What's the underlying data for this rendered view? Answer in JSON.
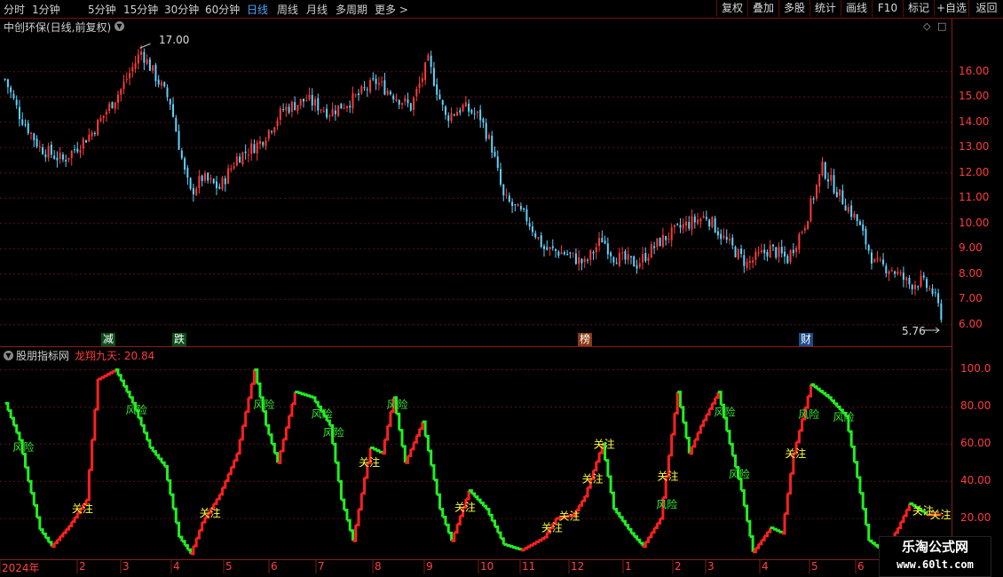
{
  "toolbar": {
    "periods": [
      "分时",
      "1分钟",
      "5分钟",
      "15分钟",
      "30分钟",
      "60分钟",
      "日线",
      "周线",
      "月线",
      "多周期",
      "更多 >"
    ],
    "active_period": "日线",
    "right_buttons": [
      "复权",
      "叠加",
      "多股",
      "统计",
      "画线",
      "F10",
      "标记",
      "+自选",
      "返回"
    ]
  },
  "main_panel": {
    "title": "中创环保(日线,前复权)",
    "high_label": "17.00",
    "low_label": "5.76",
    "y_ticks": [
      "16.00",
      "15.00",
      "14.00",
      "13.00",
      "12.00",
      "11.00",
      "10.00",
      "9.00",
      "8.00",
      "7.00",
      "6.00"
    ],
    "event_tags": [
      "减",
      "跌",
      "榜",
      "财"
    ]
  },
  "indicator_panel": {
    "source": "股朋指标网",
    "name_value": "龙翔九天: 20.84",
    "y_ticks": [
      "100.0",
      "80.00",
      "60.00",
      "40.00",
      "20.00"
    ],
    "label_risk": "风险",
    "label_watch": "关注"
  },
  "x_axis": {
    "months": [
      "2024年",
      "2",
      "3",
      "4",
      "5",
      "6",
      "7",
      "8",
      "9",
      "10",
      "11",
      "12",
      "1",
      "2",
      "3",
      "4",
      "5",
      "6"
    ]
  },
  "watermark": {
    "line1": "乐淘公式网",
    "line2": "www.60lt.com"
  },
  "colors": {
    "up": "#ff3a3a",
    "down": "#5fd3ff",
    "ind_up": "#ff2020",
    "ind_down": "#22ee22",
    "risk": "#33ee33",
    "watch": "#ffff40"
  },
  "chart_data": {
    "type": "candlestick_with_indicator",
    "price_ylim": [
      5.5,
      17.5
    ],
    "price_high": 17.0,
    "price_low": 5.76,
    "price_path": [
      [
        0,
        15.7
      ],
      [
        5,
        14.3
      ],
      [
        12,
        13.0
      ],
      [
        20,
        12.5
      ],
      [
        30,
        13.6
      ],
      [
        40,
        15.3
      ],
      [
        47,
        16.8
      ],
      [
        52,
        15.8
      ],
      [
        57,
        14.8
      ],
      [
        62,
        12.0
      ],
      [
        64,
        11.2
      ],
      [
        68,
        11.8
      ],
      [
        74,
        11.4
      ],
      [
        80,
        12.6
      ],
      [
        88,
        13.2
      ],
      [
        96,
        14.5
      ],
      [
        104,
        14.9
      ],
      [
        112,
        14.4
      ],
      [
        120,
        14.9
      ],
      [
        128,
        15.6
      ],
      [
        134,
        15.1
      ],
      [
        140,
        14.6
      ],
      [
        146,
        16.4
      ],
      [
        152,
        14.2
      ],
      [
        158,
        14.6
      ],
      [
        164,
        14.2
      ],
      [
        168,
        13.0
      ],
      [
        172,
        11.0
      ],
      [
        180,
        10.2
      ],
      [
        186,
        9.0
      ],
      [
        194,
        8.8
      ],
      [
        200,
        8.4
      ],
      [
        206,
        9.4
      ],
      [
        210,
        8.7
      ],
      [
        218,
        8.4
      ],
      [
        226,
        9.3
      ],
      [
        234,
        9.9
      ],
      [
        242,
        10.3
      ],
      [
        248,
        9.4
      ],
      [
        256,
        8.4
      ],
      [
        264,
        9.0
      ],
      [
        270,
        8.6
      ],
      [
        276,
        10.0
      ],
      [
        282,
        12.2
      ],
      [
        288,
        11.1
      ],
      [
        294,
        10.1
      ],
      [
        300,
        8.4
      ],
      [
        306,
        8.2
      ],
      [
        312,
        7.6
      ],
      [
        316,
        7.7
      ],
      [
        320,
        7.3
      ],
      [
        323,
        6.4
      ]
    ],
    "indicator_ylim": [
      0,
      105
    ],
    "indicator_path": [
      [
        0,
        82
      ],
      [
        5,
        62
      ],
      [
        8,
        40
      ],
      [
        12,
        14
      ],
      [
        16,
        5
      ],
      [
        22,
        16
      ],
      [
        28,
        30
      ],
      [
        32,
        95
      ],
      [
        38,
        100
      ],
      [
        44,
        82
      ],
      [
        50,
        58
      ],
      [
        55,
        48
      ],
      [
        60,
        10
      ],
      [
        64,
        1
      ],
      [
        68,
        18
      ],
      [
        74,
        33
      ],
      [
        80,
        55
      ],
      [
        86,
        100
      ],
      [
        90,
        70
      ],
      [
        94,
        50
      ],
      [
        100,
        88
      ],
      [
        106,
        85
      ],
      [
        112,
        70
      ],
      [
        116,
        30
      ],
      [
        120,
        8
      ],
      [
        124,
        42
      ],
      [
        126,
        58
      ],
      [
        130,
        55
      ],
      [
        134,
        85
      ],
      [
        138,
        50
      ],
      [
        144,
        72
      ],
      [
        150,
        25
      ],
      [
        154,
        8
      ],
      [
        160,
        35
      ],
      [
        166,
        25
      ],
      [
        172,
        6
      ],
      [
        178,
        3
      ],
      [
        186,
        10
      ],
      [
        190,
        20
      ],
      [
        196,
        22
      ],
      [
        200,
        32
      ],
      [
        206,
        60
      ],
      [
        210,
        25
      ],
      [
        216,
        12
      ],
      [
        220,
        5
      ],
      [
        226,
        20
      ],
      [
        232,
        88
      ],
      [
        236,
        55
      ],
      [
        240,
        70
      ],
      [
        246,
        88
      ],
      [
        250,
        60
      ],
      [
        254,
        35
      ],
      [
        258,
        2
      ],
      [
        264,
        15
      ],
      [
        268,
        12
      ],
      [
        272,
        55
      ],
      [
        278,
        92
      ],
      [
        284,
        85
      ],
      [
        290,
        75
      ],
      [
        294,
        42
      ],
      [
        298,
        8
      ],
      [
        303,
        2
      ],
      [
        308,
        15
      ],
      [
        312,
        28
      ],
      [
        318,
        22
      ],
      [
        322,
        22
      ]
    ],
    "risk_labels_at": [
      5,
      44,
      88,
      108,
      112,
      134,
      227,
      247,
      252,
      276,
      288
    ],
    "watch_labels_at": [
      26,
      70,
      125,
      158,
      188,
      194,
      202,
      206,
      228,
      272,
      316,
      322
    ]
  }
}
